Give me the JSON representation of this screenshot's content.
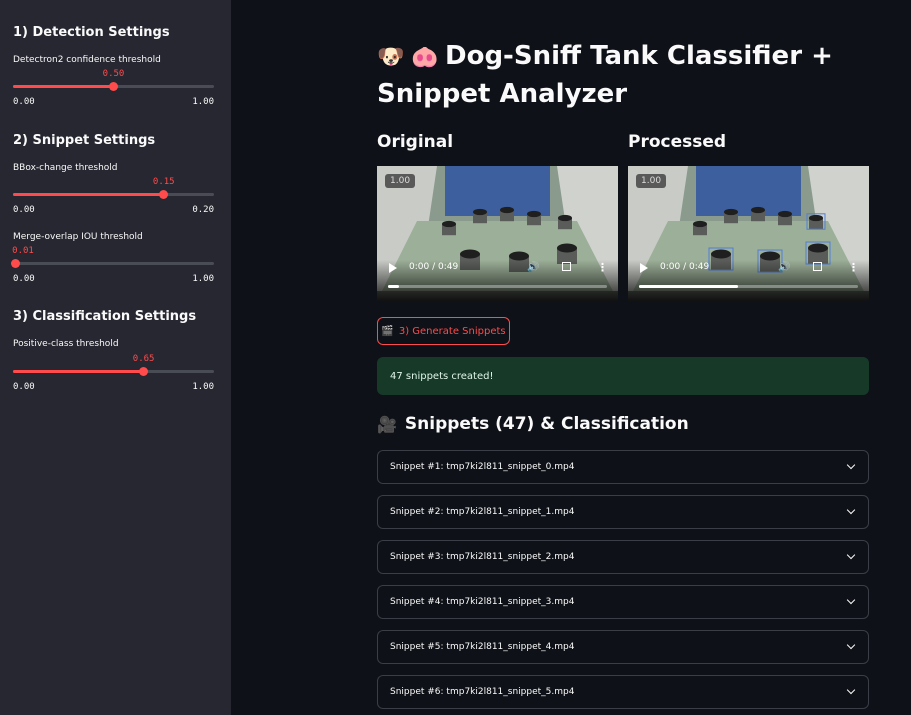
{
  "sidebar": {
    "sections": [
      {
        "title": "1) Detection Settings",
        "sliders": [
          {
            "label": "Detectron2 confidence threshold",
            "value": "0.50",
            "fraction": 0.5,
            "min": "0.00",
            "max": "1.00"
          }
        ]
      },
      {
        "title": "2) Snippet Settings",
        "sliders": [
          {
            "label": "BBox-change threshold",
            "value": "0.15",
            "fraction": 0.75,
            "min": "0.00",
            "max": "0.20"
          },
          {
            "label": "Merge-overlap IOU threshold",
            "value": "0.01",
            "fraction": 0.01,
            "min": "0.00",
            "max": "1.00"
          }
        ]
      },
      {
        "title": "3) Classification Settings",
        "sliders": [
          {
            "label": "Positive-class threshold",
            "value": "0.65",
            "fraction": 0.65,
            "min": "0.00",
            "max": "1.00"
          }
        ]
      }
    ]
  },
  "main": {
    "title_emoji_1": "🐶",
    "title_emoji_2": "🐽",
    "title": "Dog-Sniff Tank Classifier + Snippet Analyzer",
    "original_header": "Original",
    "processed_header": "Processed",
    "videos": [
      {
        "speed": "1.00",
        "time": "0:00 / 0:49",
        "progress": 0.05
      },
      {
        "speed": "1.00",
        "time": "0:00 / 0:49",
        "progress": 0.45
      }
    ],
    "generate_button": "3) Generate Snippets",
    "generate_icon": "🎬",
    "success_message": "47 snippets created!",
    "snippets_header": "Snippets (47) & Classification",
    "snippets_icon": "🎥",
    "snippets": [
      "Snippet #1: tmp7ki2l811_snippet_0.mp4",
      "Snippet #2: tmp7ki2l811_snippet_1.mp4",
      "Snippet #3: tmp7ki2l811_snippet_2.mp4",
      "Snippet #4: tmp7ki2l811_snippet_3.mp4",
      "Snippet #5: tmp7ki2l811_snippet_4.mp4",
      "Snippet #6: tmp7ki2l811_snippet_5.mp4"
    ]
  },
  "colors": {
    "accent": "#ff4b4b",
    "sidebar_bg": "#262730",
    "app_bg": "#0e1117",
    "success_bg": "#173928"
  }
}
